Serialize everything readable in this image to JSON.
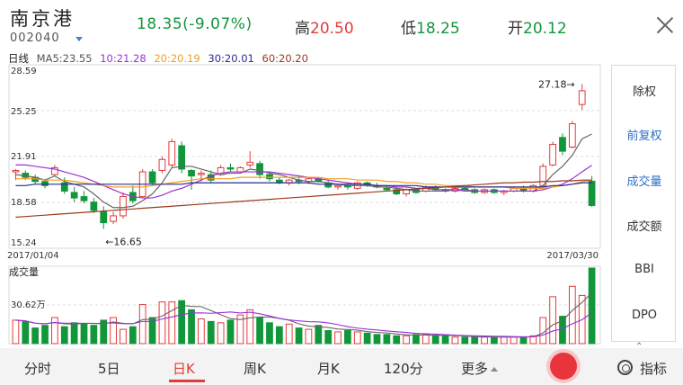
{
  "stock": {
    "name": "南京港",
    "code": "002040",
    "price_line": "18.35(-9.07%)",
    "high_label": "高",
    "high": "20.50",
    "low_label": "低",
    "low": "18.25",
    "open_label": "开",
    "open": "20.12"
  },
  "ma_bar": {
    "period": "日线",
    "ma5": "MA5:23.55",
    "ma10": "10:21.28",
    "ma20": "20:20.19",
    "ma30": "30:20.01",
    "ma60": "60:20.20"
  },
  "colors": {
    "up": "#e23b3b",
    "down": "#12963a",
    "ma5": "#666666",
    "ma10": "#9b30d9",
    "ma20": "#f0a020",
    "ma30": "#2b2b9a",
    "ma60": "#9a3b1b",
    "active_tab": "#e23b3b",
    "active_side": "#2f6fc9"
  },
  "chart": {
    "price_ticks": [
      "28.59",
      "25.25",
      "21.91",
      "18.58",
      "15.24"
    ],
    "date_start": "2017/01/04",
    "date_end": "2017/03/30",
    "max_note": "27.18→",
    "min_note": "←16.65",
    "volume_title": "成交量",
    "volume_tick": "30.62万"
  },
  "chart_data": {
    "type": "candlestick",
    "ylim": [
      15.24,
      28.59
    ],
    "max_price": 27.18,
    "min_price": 16.65,
    "candles": [
      [
        20.8,
        21.0,
        20.2,
        20.9
      ],
      [
        20.7,
        20.9,
        20.2,
        20.4
      ],
      [
        20.4,
        20.6,
        19.9,
        20.1
      ],
      [
        20.1,
        20.3,
        19.6,
        19.8
      ],
      [
        20.6,
        21.3,
        20.5,
        21.1
      ],
      [
        20.0,
        20.4,
        19.2,
        19.4
      ],
      [
        19.3,
        19.7,
        18.6,
        18.9
      ],
      [
        19.0,
        19.4,
        18.5,
        18.7
      ],
      [
        18.6,
        18.9,
        17.8,
        18.0
      ],
      [
        17.9,
        18.3,
        16.65,
        17.1
      ],
      [
        17.2,
        17.9,
        17.0,
        17.6
      ],
      [
        17.6,
        19.3,
        17.4,
        19.0
      ],
      [
        19.3,
        19.8,
        18.5,
        18.7
      ],
      [
        19.0,
        21.0,
        18.9,
        20.8
      ],
      [
        20.8,
        21.0,
        19.8,
        20.0
      ],
      [
        20.9,
        21.9,
        20.7,
        21.7
      ],
      [
        21.3,
        23.2,
        21.1,
        23.0
      ],
      [
        22.7,
        23.0,
        20.7,
        21.0
      ],
      [
        20.9,
        21.0,
        19.5,
        20.5
      ],
      [
        20.6,
        20.9,
        20.1,
        20.7
      ],
      [
        20.6,
        20.9,
        20.0,
        20.2
      ],
      [
        20.6,
        21.3,
        20.5,
        21.1
      ],
      [
        21.1,
        21.4,
        20.8,
        21.0
      ],
      [
        20.8,
        21.2,
        20.7,
        21.1
      ],
      [
        21.3,
        22.3,
        21.1,
        21.5
      ],
      [
        21.4,
        21.6,
        20.3,
        20.6
      ],
      [
        20.6,
        20.8,
        20.1,
        20.3
      ],
      [
        20.2,
        20.4,
        19.9,
        20.0
      ],
      [
        20.0,
        20.3,
        19.8,
        20.2
      ],
      [
        20.2,
        20.4,
        19.9,
        20.1
      ],
      [
        20.1,
        20.4,
        19.9,
        20.3
      ],
      [
        20.3,
        20.4,
        20.0,
        20.1
      ],
      [
        20.0,
        20.2,
        19.6,
        19.7
      ],
      [
        19.7,
        19.9,
        19.5,
        19.8
      ],
      [
        19.8,
        20.0,
        19.5,
        19.7
      ],
      [
        19.6,
        20.1,
        19.5,
        20.0
      ],
      [
        20.0,
        20.1,
        19.7,
        19.8
      ],
      [
        19.8,
        20.0,
        19.6,
        19.7
      ],
      [
        19.6,
        19.8,
        19.4,
        19.5
      ],
      [
        19.5,
        19.6,
        19.1,
        19.2
      ],
      [
        19.2,
        19.6,
        19.0,
        19.5
      ],
      [
        19.5,
        19.6,
        19.2,
        19.3
      ],
      [
        19.4,
        19.8,
        19.3,
        19.7
      ],
      [
        19.7,
        19.8,
        19.4,
        19.5
      ],
      [
        19.5,
        19.6,
        19.3,
        19.4
      ],
      [
        19.4,
        19.7,
        19.3,
        19.6
      ],
      [
        19.6,
        19.7,
        19.4,
        19.5
      ],
      [
        19.5,
        19.6,
        19.2,
        19.3
      ],
      [
        19.3,
        19.6,
        19.2,
        19.5
      ],
      [
        19.5,
        19.6,
        19.2,
        19.3
      ],
      [
        19.3,
        19.5,
        19.1,
        19.4
      ],
      [
        19.4,
        19.7,
        19.3,
        19.6
      ],
      [
        19.6,
        19.8,
        19.3,
        19.4
      ],
      [
        19.4,
        19.9,
        19.3,
        19.8
      ],
      [
        19.8,
        21.4,
        19.7,
        21.2
      ],
      [
        21.3,
        23.0,
        21.2,
        22.8
      ],
      [
        23.3,
        23.6,
        22.0,
        22.3
      ],
      [
        22.6,
        24.5,
        22.5,
        24.3
      ],
      [
        25.7,
        27.18,
        25.3,
        26.7
      ],
      [
        20.12,
        20.5,
        18.25,
        18.35
      ]
    ],
    "volume": [
      18,
      17,
      12,
      14,
      20,
      13,
      16,
      15,
      14,
      18,
      20,
      11,
      13,
      30,
      20,
      32,
      32,
      33,
      26,
      19,
      17,
      16,
      18,
      22,
      26,
      20,
      16,
      13,
      15,
      12,
      11,
      14,
      10,
      9,
      10,
      9,
      8,
      7,
      7,
      6,
      6,
      7,
      7,
      6,
      6,
      5,
      5,
      5,
      5,
      5,
      5,
      5,
      5,
      6,
      20,
      36,
      21,
      44,
      37,
      58
    ],
    "volume_scale": 30.62,
    "series": [
      {
        "name": "MA5",
        "values": [
          20.6,
          20.5,
          20.4,
          20.2,
          20.5,
          20.1,
          19.9,
          19.7,
          19.2,
          18.6,
          18.2,
          18.2,
          18.3,
          18.7,
          19.2,
          20.0,
          21.1,
          21.2,
          21.2,
          21.0,
          20.8,
          20.6,
          20.7,
          20.7,
          21.0,
          20.9,
          20.7,
          20.6,
          20.4,
          20.2,
          20.1,
          20.1,
          20.0,
          19.9,
          19.8,
          19.8,
          19.8,
          19.7,
          19.7,
          19.6,
          19.5,
          19.4,
          19.4,
          19.4,
          19.4,
          19.5,
          19.5,
          19.4,
          19.4,
          19.4,
          19.4,
          19.4,
          19.4,
          19.4,
          19.8,
          20.6,
          21.2,
          22.0,
          23.2,
          23.55
        ]
      },
      {
        "name": "MA10",
        "values": [
          21.3,
          21.3,
          21.2,
          21.1,
          21.0,
          20.8,
          20.6,
          20.4,
          20.1,
          19.8,
          19.5,
          19.2,
          19.0,
          18.9,
          18.9,
          19.1,
          19.4,
          19.6,
          19.9,
          20.2,
          20.5,
          20.7,
          20.8,
          20.8,
          20.8,
          20.8,
          20.8,
          20.7,
          20.6,
          20.5,
          20.4,
          20.3,
          20.2,
          20.1,
          20.0,
          19.9,
          19.9,
          19.8,
          19.8,
          19.7,
          19.7,
          19.6,
          19.6,
          19.5,
          19.5,
          19.5,
          19.4,
          19.4,
          19.4,
          19.4,
          19.4,
          19.4,
          19.4,
          19.4,
          19.5,
          19.7,
          19.9,
          20.3,
          20.8,
          21.28
        ]
      },
      {
        "name": "MA20",
        "values": [
          20.3,
          20.3,
          20.3,
          20.2,
          20.2,
          20.2,
          20.1,
          20.0,
          19.9,
          19.8,
          19.7,
          19.7,
          19.7,
          19.7,
          19.8,
          19.9,
          20.0,
          20.1,
          20.2,
          20.3,
          20.3,
          20.3,
          20.3,
          20.4,
          20.4,
          20.4,
          20.4,
          20.4,
          20.4,
          20.4,
          20.4,
          20.4,
          20.3,
          20.3,
          20.3,
          20.2,
          20.2,
          20.2,
          20.1,
          20.1,
          20.0,
          20.0,
          19.9,
          19.9,
          19.8,
          19.8,
          19.8,
          19.7,
          19.7,
          19.7,
          19.7,
          19.6,
          19.6,
          19.6,
          19.6,
          19.7,
          19.8,
          19.9,
          20.1,
          20.19
        ]
      },
      {
        "name": "MA30",
        "values": [
          19.8,
          19.8,
          19.9,
          19.9,
          19.9,
          19.9,
          19.9,
          19.9,
          19.9,
          19.9,
          19.9,
          19.9,
          19.9,
          19.9,
          19.9,
          19.9,
          19.9,
          19.9,
          20.0,
          20.0,
          20.0,
          20.0,
          20.0,
          20.0,
          20.0,
          20.0,
          20.0,
          20.0,
          20.0,
          20.0,
          20.0,
          19.9,
          19.9,
          19.9,
          19.9,
          19.9,
          19.9,
          19.8,
          19.8,
          19.8,
          19.8,
          19.8,
          19.7,
          19.7,
          19.7,
          19.7,
          19.7,
          19.7,
          19.7,
          19.7,
          19.7,
          19.7,
          19.7,
          19.7,
          19.7,
          19.8,
          19.8,
          19.9,
          20.0,
          20.01
        ]
      },
      {
        "name": "MA60",
        "values": [
          17.5,
          17.55,
          17.6,
          17.65,
          17.7,
          17.75,
          17.8,
          17.85,
          17.9,
          17.95,
          18.0,
          18.05,
          18.1,
          18.15,
          18.2,
          18.25,
          18.3,
          18.35,
          18.4,
          18.45,
          18.5,
          18.55,
          18.6,
          18.65,
          18.7,
          18.75,
          18.8,
          18.85,
          18.9,
          18.95,
          19.0,
          19.05,
          19.1,
          19.15,
          19.2,
          19.25,
          19.3,
          19.35,
          19.4,
          19.45,
          19.5,
          19.55,
          19.6,
          19.65,
          19.7,
          19.75,
          19.8,
          19.85,
          19.9,
          19.95,
          20.0,
          20.0,
          20.05,
          20.05,
          20.1,
          20.1,
          20.15,
          20.15,
          20.2,
          20.2
        ]
      }
    ]
  },
  "side_menu": [
    "除权",
    "前复权",
    "成交量",
    "成交额",
    "BBI",
    "DPO"
  ],
  "side_handle": "⌃",
  "tabs": [
    "分时",
    "5日",
    "日K",
    "周K",
    "月K",
    "120分",
    "更多"
  ],
  "indicator_label": "指标"
}
